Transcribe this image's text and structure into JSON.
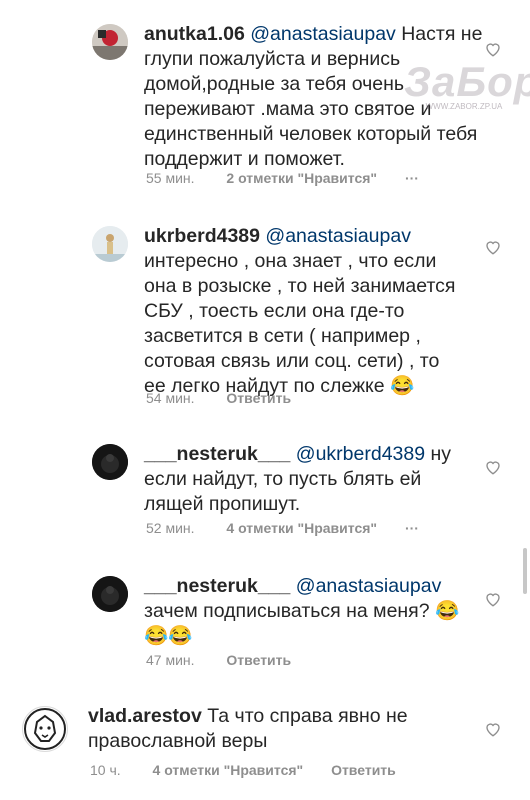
{
  "watermark": {
    "logo": "ЗаБор",
    "site": "WWW.ZABOR.ZP.UA"
  },
  "comments": [
    {
      "username": "anutka1.06",
      "mention": "@anastasiaupav",
      "text": "Настя не глупи пожалуйста и вернись домой,родные за тебя очень переживают .мама это святое и единственный человек который тебя поддержит и поможет.",
      "time": "55 мин.",
      "likes": "2 отметки \"Нравится\"",
      "reply": ""
    },
    {
      "username": "ukrberd4389",
      "mention": "@anastasiaupav",
      "text": "интересно , она знает , что если она в розыске , то ней занимается СБУ , тоесть если она где-то засветится в сети ( например , сотовая связь или соц. сети) , то ее легко найдут по слежке",
      "emoji": "😂",
      "time": "54 мин.",
      "likes": "",
      "reply": "Ответить"
    },
    {
      "username": "___nesteruk___",
      "mention": "@ukrberd4389",
      "text": "ну если найдут, то пусть блять ей лящей пропишут.",
      "time": "52 мин.",
      "likes": "4 отметки \"Нравится\"",
      "reply": ""
    },
    {
      "username": "___nesteruk___",
      "mention": "@anastasiaupav",
      "text": "зачем подписываться на меня?",
      "emoji": "😂😂😂",
      "time": "47 мин.",
      "likes": "",
      "reply": "Ответить"
    },
    {
      "username": "vlad.arestov",
      "mention": "",
      "text": "Та что справа явно не православной веры",
      "time": "10 ч.",
      "likes": "4 отметки \"Нравится\"",
      "reply": "Ответить"
    }
  ],
  "colors": {
    "text": "#262626",
    "mention": "#00376b",
    "meta": "#8e8e8e"
  }
}
